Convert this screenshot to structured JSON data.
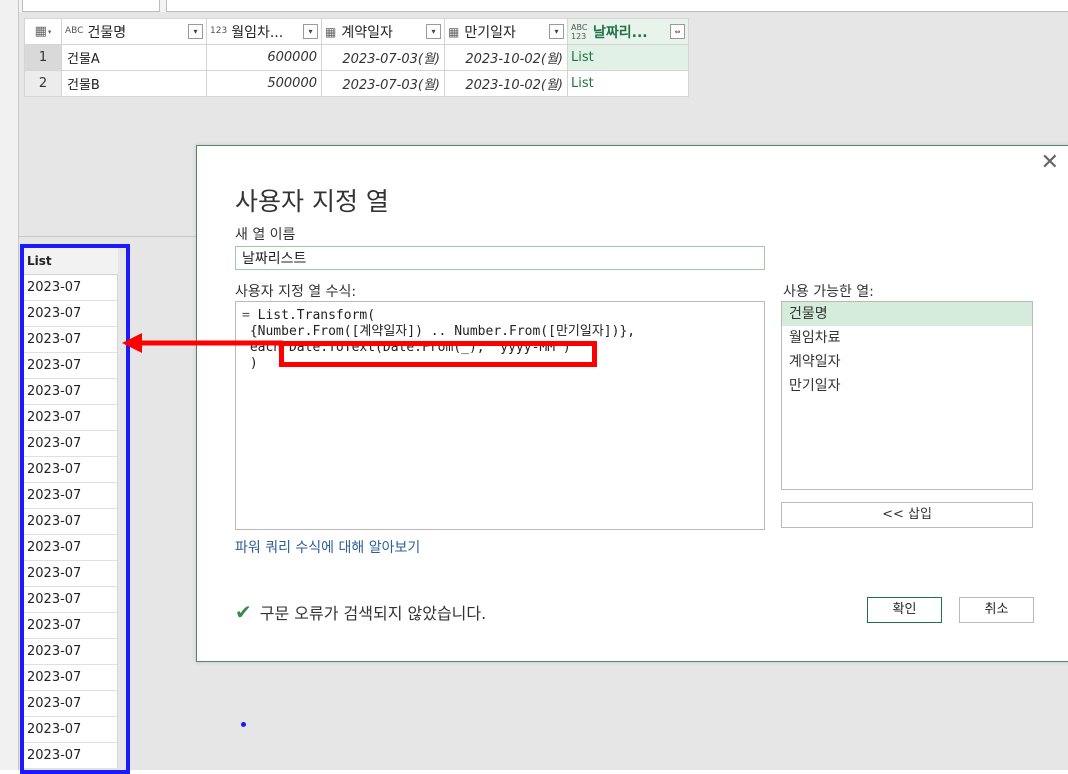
{
  "table": {
    "columns": [
      {
        "type_icon": "ABC",
        "name": "건물명"
      },
      {
        "type_icon": "123",
        "name": "월임차..."
      },
      {
        "type_icon": "calendar-icon",
        "name": "계약일자"
      },
      {
        "type_icon": "calendar-icon",
        "name": "만기일자"
      },
      {
        "type_icon": "ABC 123",
        "name": "날짜리..."
      }
    ],
    "rows": [
      {
        "num": "1",
        "building": "건물A",
        "rent": "600000",
        "contract": "2023-07-03(월)",
        "expiry": "2023-10-02(월)",
        "list": "List"
      },
      {
        "num": "2",
        "building": "건물B",
        "rent": "500000",
        "contract": "2023-07-03(월)",
        "expiry": "2023-10-02(월)",
        "list": "List"
      }
    ]
  },
  "list_panel": {
    "header": "List",
    "items": [
      "2023-07",
      "2023-07",
      "2023-07",
      "2023-07",
      "2023-07",
      "2023-07",
      "2023-07",
      "2023-07",
      "2023-07",
      "2023-07",
      "2023-07",
      "2023-07",
      "2023-07",
      "2023-07",
      "2023-07",
      "2023-07",
      "2023-07",
      "2023-07",
      "2023-07"
    ]
  },
  "dialog": {
    "title": "사용자 지정 열",
    "name_label": "새 열 이름",
    "name_value": "날짜리스트",
    "formula_label": "사용자 지정 열 수식:",
    "formula_eq": "=",
    "formula_lines": [
      "List.Transform(",
      " {Number.From([계약일자]) .. Number.From([만기일자])},",
      " each Date.ToText(Date.From(_), \"yyyy-MM\")",
      " )"
    ],
    "available_label": "사용 가능한 열:",
    "available_columns": [
      "건물명",
      "월임차료",
      "계약일자",
      "만기일자"
    ],
    "insert_button": "<< 삽입",
    "learn_link": "파워 쿼리 수식에 대해 알아보기",
    "status_text": "구문 오류가 검색되지 않았습니다.",
    "ok_button": "확인",
    "cancel_button": "취소"
  },
  "colors": {
    "highlight_red": "#ff0000",
    "highlight_blue": "#1a19ff",
    "accent_green": "#217346"
  }
}
